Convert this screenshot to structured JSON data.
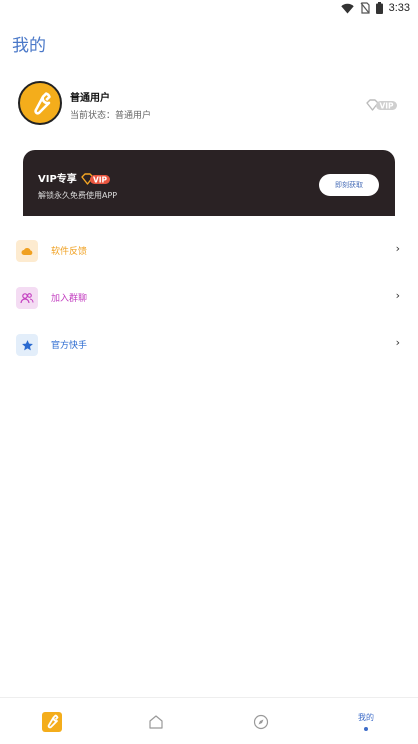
{
  "status_bar": {
    "time": "3:33"
  },
  "page": {
    "title": "我的"
  },
  "profile": {
    "username": "普通用户",
    "status_label": "当前状态：",
    "status_value": "普通用户",
    "vip_badge": "VIP"
  },
  "vip_card": {
    "title": "VIP专享",
    "tag": "VIP",
    "subtitle": "解锁永久免费使用APP",
    "button_label": "即刻获取"
  },
  "menu": {
    "items": [
      {
        "label": "软件反馈",
        "icon": "cloud-icon",
        "color": "#f0a020",
        "bg": "#fdebd0"
      },
      {
        "label": "加入群聊",
        "icon": "group-icon",
        "color": "#c33fc0",
        "bg": "#f4dcf3"
      },
      {
        "label": "官方快手",
        "icon": "star-icon",
        "color": "#2a6ad0",
        "bg": "#e3eefa"
      }
    ],
    "arrow": "›"
  },
  "tabbar": {
    "active_label": "我的",
    "accent": "#3e6cc8"
  }
}
